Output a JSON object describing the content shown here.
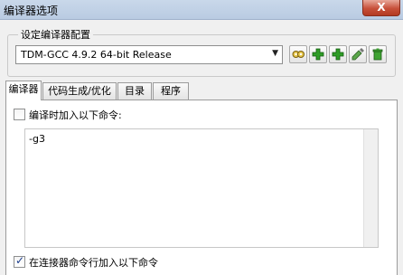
{
  "window": {
    "title": "编译器选项",
    "close_label": "X"
  },
  "compiler_set": {
    "legend": "设定编译器配置",
    "selected": "TDM-GCC 4.9.2 64-bit Release",
    "buttons": [
      {
        "name": "compiler-settings-button",
        "icon": "gears-icon"
      },
      {
        "name": "add-compiler-button",
        "icon": "add-icon"
      },
      {
        "name": "add-compiler-folder-button",
        "icon": "add-icon"
      },
      {
        "name": "rename-compiler-button",
        "icon": "rename-icon"
      },
      {
        "name": "delete-compiler-button",
        "icon": "trash-icon"
      }
    ]
  },
  "tabs": [
    {
      "label": "编译器",
      "active": true
    },
    {
      "label": "代码生成/优化",
      "active": false
    },
    {
      "label": "目录",
      "active": false
    },
    {
      "label": "程序",
      "active": false
    }
  ],
  "compiler_tab": {
    "compile_commands": {
      "label": "编译时加入以下命令:",
      "checked": false,
      "value": "-g3"
    },
    "linker_commands": {
      "label": "在连接器命令行加入以下命令",
      "checked": true
    }
  },
  "colors": {
    "title_bar": "#b9cbe2",
    "close_button": "#c7503a",
    "add_icon_green": "#2f9d27"
  }
}
